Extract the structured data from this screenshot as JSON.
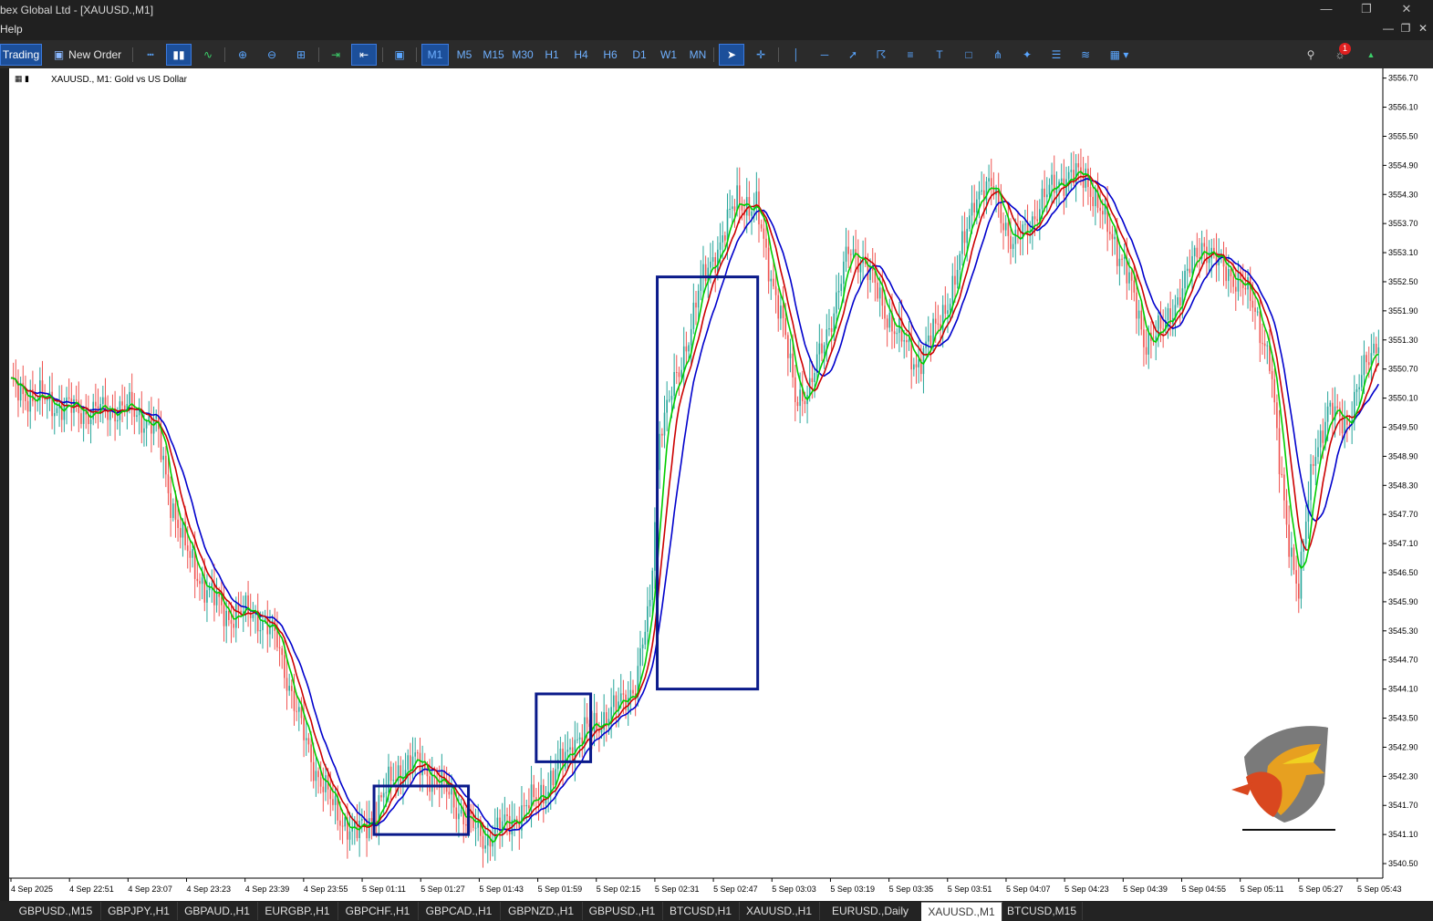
{
  "window": {
    "title": "bex Global Ltd - [XAUUSD.,M1]",
    "menu_help": "Help"
  },
  "toolbar": {
    "trading_label": "Trading",
    "new_order_label": "New Order",
    "timeframes": [
      "M1",
      "M5",
      "M15",
      "M30",
      "H1",
      "H4",
      "H6",
      "D1",
      "W1",
      "MN"
    ],
    "active_timeframe": "M1",
    "notification_count": "1"
  },
  "chart": {
    "header": "XAUUSD., M1:  Gold vs US Dollar",
    "colors": {
      "bull": "#26a69a",
      "bear": "#ef5350",
      "ma_fast": "#00cc00",
      "ma_mid": "#cc0000",
      "ma_slow": "#0000cc",
      "box": "#0a1a8a"
    }
  },
  "chart_data": {
    "type": "candlestick",
    "symbol": "XAUUSD.",
    "timeframe": "M1",
    "ylim": [
      3540.2,
      3556.9
    ],
    "y_ticks": [
      "3556.70",
      "3556.10",
      "3555.50",
      "3554.90",
      "3554.30",
      "3553.70",
      "3553.10",
      "3552.50",
      "3551.90",
      "3551.30",
      "3550.70",
      "3550.10",
      "3549.50",
      "3548.90",
      "3548.30",
      "3547.70",
      "3547.10",
      "3546.50",
      "3545.90",
      "3545.30",
      "3544.70",
      "3544.10",
      "3543.50",
      "3542.90",
      "3542.30",
      "3541.70",
      "3541.10",
      "3540.50"
    ],
    "x_ticks": [
      "4 Sep 2025",
      "4 Sep 22:51",
      "4 Sep 23:07",
      "4 Sep 23:23",
      "4 Sep 23:39",
      "4 Sep 23:55",
      "5 Sep 01:11",
      "5 Sep 01:27",
      "5 Sep 01:43",
      "5 Sep 01:59",
      "5 Sep 02:15",
      "5 Sep 02:31",
      "5 Sep 02:47",
      "5 Sep 03:03",
      "5 Sep 03:19",
      "5 Sep 03:35",
      "5 Sep 03:51",
      "5 Sep 04:07",
      "5 Sep 04:23",
      "5 Sep 04:39",
      "5 Sep 04:55",
      "5 Sep 05:11",
      "5 Sep 05:27",
      "5 Sep 05:43"
    ],
    "price_path": [
      [
        0,
        3550.3
      ],
      [
        16,
        3550.0
      ],
      [
        32,
        3549.8
      ],
      [
        48,
        3549.9
      ],
      [
        60,
        3549.5
      ],
      [
        66,
        3548.0
      ],
      [
        72,
        3547.0
      ],
      [
        80,
        3546.2
      ],
      [
        90,
        3545.6
      ],
      [
        100,
        3545.7
      ],
      [
        110,
        3545.1
      ],
      [
        118,
        3543.6
      ],
      [
        126,
        3542.4
      ],
      [
        134,
        3541.6
      ],
      [
        142,
        3541.1
      ],
      [
        150,
        3541.5
      ],
      [
        158,
        3542.3
      ],
      [
        166,
        3542.6
      ],
      [
        172,
        3542.4
      ],
      [
        180,
        3542.0
      ],
      [
        188,
        3541.4
      ],
      [
        196,
        3541.0
      ],
      [
        204,
        3541.3
      ],
      [
        212,
        3541.6
      ],
      [
        222,
        3542.1
      ],
      [
        232,
        3543.0
      ],
      [
        240,
        3543.3
      ],
      [
        250,
        3543.7
      ],
      [
        258,
        3544.2
      ],
      [
        264,
        3545.8
      ],
      [
        268,
        3549.5
      ],
      [
        276,
        3550.6
      ],
      [
        284,
        3552.3
      ],
      [
        292,
        3553.2
      ],
      [
        300,
        3554.2
      ],
      [
        308,
        3554.0
      ],
      [
        312,
        3553.0
      ],
      [
        318,
        3551.9
      ],
      [
        324,
        3550.1
      ],
      [
        330,
        3550.3
      ],
      [
        338,
        3551.6
      ],
      [
        346,
        3553.1
      ],
      [
        352,
        3553.0
      ],
      [
        360,
        3552.0
      ],
      [
        368,
        3551.3
      ],
      [
        374,
        3550.8
      ],
      [
        382,
        3551.5
      ],
      [
        390,
        3552.5
      ],
      [
        398,
        3554.3
      ],
      [
        406,
        3554.4
      ],
      [
        414,
        3553.2
      ],
      [
        422,
        3553.8
      ],
      [
        432,
        3554.6
      ],
      [
        444,
        3554.7
      ],
      [
        452,
        3553.7
      ],
      [
        460,
        3552.9
      ],
      [
        468,
        3551.3
      ],
      [
        476,
        3551.5
      ],
      [
        484,
        3552.4
      ],
      [
        492,
        3553.3
      ],
      [
        500,
        3552.8
      ],
      [
        508,
        3552.5
      ],
      [
        514,
        3551.9
      ],
      [
        520,
        3550.9
      ],
      [
        524,
        3548.7
      ],
      [
        528,
        3547.2
      ],
      [
        532,
        3546.1
      ],
      [
        538,
        3548.9
      ],
      [
        544,
        3549.8
      ],
      [
        552,
        3549.6
      ],
      [
        560,
        3550.8
      ],
      [
        565,
        3551.4
      ]
    ],
    "series": [],
    "grid": false,
    "legend": "none"
  }
}
